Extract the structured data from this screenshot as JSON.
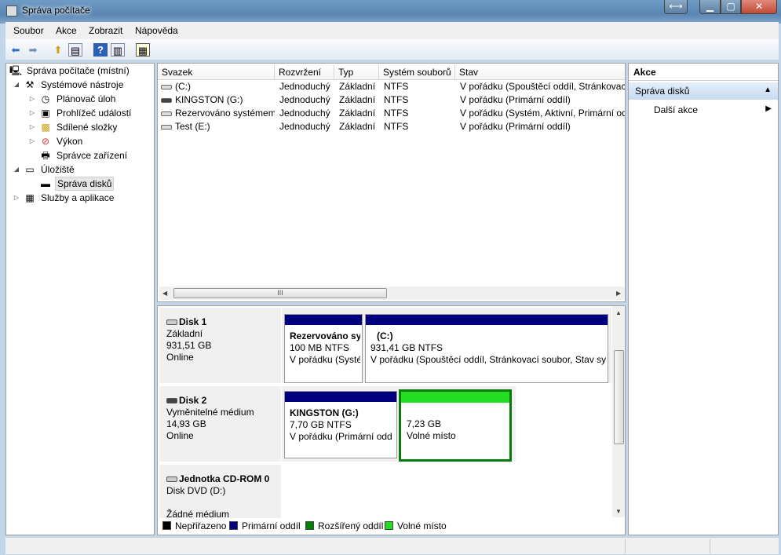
{
  "window": {
    "title": "Správa počítače"
  },
  "menu": [
    "Soubor",
    "Akce",
    "Zobrazit",
    "Nápověda"
  ],
  "tree": {
    "root": "Správa počítače (místní)",
    "system_tools": "Systémové nástroje",
    "task_scheduler": "Plánovač úloh",
    "event_viewer": "Prohlížeč událostí",
    "shared_folders": "Sdílené složky",
    "performance": "Výkon",
    "device_manager": "Správce zařízení",
    "storage": "Úložiště",
    "disk_management": "Správa disků",
    "services": "Služby a aplikace"
  },
  "volume_list": {
    "headers": [
      "Svazek",
      "Rozvržení",
      "Typ",
      "Systém souborů",
      "Stav"
    ],
    "rows": [
      [
        "(C:)",
        "Jednoduchý",
        "Základní",
        "NTFS",
        "V pořádku (Spouštěcí oddíl, Stránkovací"
      ],
      [
        "KINGSTON (G:)",
        "Jednoduchý",
        "Základní",
        "NTFS",
        "V pořádku (Primární oddíl)"
      ],
      [
        "Rezervováno systémem",
        "Jednoduchý",
        "Základní",
        "NTFS",
        "V pořádku (Systém, Aktivní, Primární od"
      ],
      [
        "Test (E:)",
        "Jednoduchý",
        "Základní",
        "NTFS",
        "V pořádku (Primární oddíl)"
      ]
    ],
    "scroll_grip": "III"
  },
  "disks": [
    {
      "name": "Disk 1",
      "type": "Základní",
      "size": "931,51 GB",
      "status": "Online",
      "partitions": [
        {
          "title": "Rezervováno sy",
          "size": "100 MB NTFS",
          "state": "V pořádku (Systé",
          "color": "#00007f"
        },
        {
          "title": "(C:)",
          "size": "931,41 GB NTFS",
          "state": "V pořádku (Spouštěcí oddíl, Stránkovací soubor, Stav sys",
          "color": "#00007f"
        }
      ]
    },
    {
      "name": "Disk 2",
      "type": "Vyměnitelné médium",
      "size": "14,93 GB",
      "status": "Online",
      "partitions": [
        {
          "title": "KINGSTON  (G:)",
          "size": "7,70 GB NTFS",
          "state": "V pořádku (Primární odd",
          "color": "#00007f"
        },
        {
          "title": "",
          "size": "7,23 GB",
          "state": "Volné místo",
          "color": "#22dd22"
        }
      ]
    },
    {
      "name": "Jednotka CD-ROM 0",
      "type": "Disk DVD (D:)",
      "size": "",
      "status": "Žádné médium"
    }
  ],
  "legend": [
    {
      "label": "Nepřiřazeno",
      "color": "#000000"
    },
    {
      "label": "Primární oddíl",
      "color": "#00007f"
    },
    {
      "label": "Rozšířený oddíl",
      "color": "#008000"
    },
    {
      "label": "Volné místo",
      "color": "#22dd22"
    }
  ],
  "actions": {
    "header": "Akce",
    "selected": "Správa disků",
    "more": "Další akce"
  }
}
